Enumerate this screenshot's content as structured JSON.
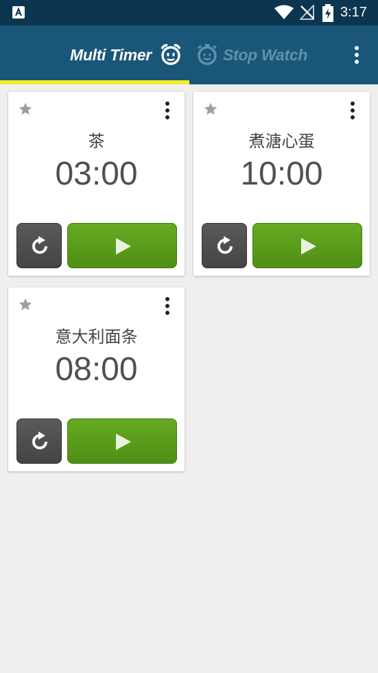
{
  "status_bar": {
    "time": "3:17",
    "icons": [
      "app-notification-icon",
      "wifi-icon",
      "no-signal-icon",
      "battery-charging-icon"
    ]
  },
  "app_bar": {
    "tabs": [
      {
        "label": "Multi Timer",
        "icon": "alarm-clock-icon",
        "selected": true
      },
      {
        "label": "Stop Watch",
        "icon": "stopwatch-icon",
        "selected": false
      }
    ],
    "menu_icon": "overflow-menu-icon",
    "accent_color": "#f2ef2a",
    "background_color": "#1a5678"
  },
  "timers": [
    {
      "name": "茶",
      "time": "03:00"
    },
    {
      "name": "煮溏心蛋",
      "time": "10:00"
    },
    {
      "name": "意大利面条",
      "time": "08:00"
    }
  ],
  "colors": {
    "play_button": "#5c9f1c",
    "reset_button": "#4f4f4f",
    "status_bar": "#0c3550"
  }
}
